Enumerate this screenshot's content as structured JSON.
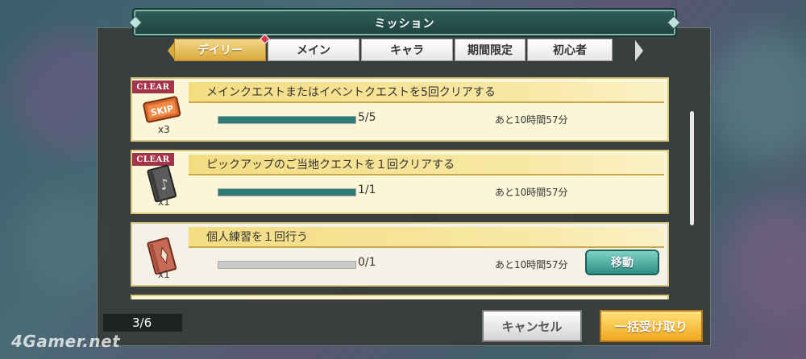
{
  "dialog": {
    "title": "ミッション",
    "tabs": [
      {
        "label": "デイリー",
        "active": true,
        "notification": true
      },
      {
        "label": "メイン",
        "active": false
      },
      {
        "label": "キャラ",
        "active": false
      },
      {
        "label": "期間限定",
        "active": false
      },
      {
        "label": "初心者",
        "active": false
      }
    ],
    "missions": [
      {
        "badge": "CLEAR",
        "title": "メインクエストまたはイベントクエストを5回クリアする",
        "reward_icon": "skip-ticket-icon",
        "reward_label": "SKIP",
        "quantity": "x3",
        "progress_text": "5/5",
        "progress_fraction": 1.0,
        "time_left": "あと10時間57分"
      },
      {
        "badge": "CLEAR",
        "title": "ピックアップのご当地クエストを１回クリアする",
        "reward_icon": "music-book-icon",
        "quantity": "x1",
        "progress_text": "1/1",
        "progress_fraction": 1.0,
        "time_left": "あと10時間57分"
      },
      {
        "title": "個人練習を１回行う",
        "reward_icon": "red-book-icon",
        "quantity": "x1",
        "progress_text": "0/1",
        "progress_fraction": 0.0,
        "time_left": "あと10時間57分",
        "action_label": "移動"
      }
    ]
  },
  "footer": {
    "page_indicator": "3/6",
    "cancel_label": "キャンセル",
    "receive_all_label": "一括受け取り"
  },
  "watermark": "4Gamer.net",
  "colors": {
    "tab_active": "#d9a83a",
    "clear_badge": "#a3344a",
    "progress_fill": "#2d7a76",
    "go_button": "#2f8f84"
  }
}
